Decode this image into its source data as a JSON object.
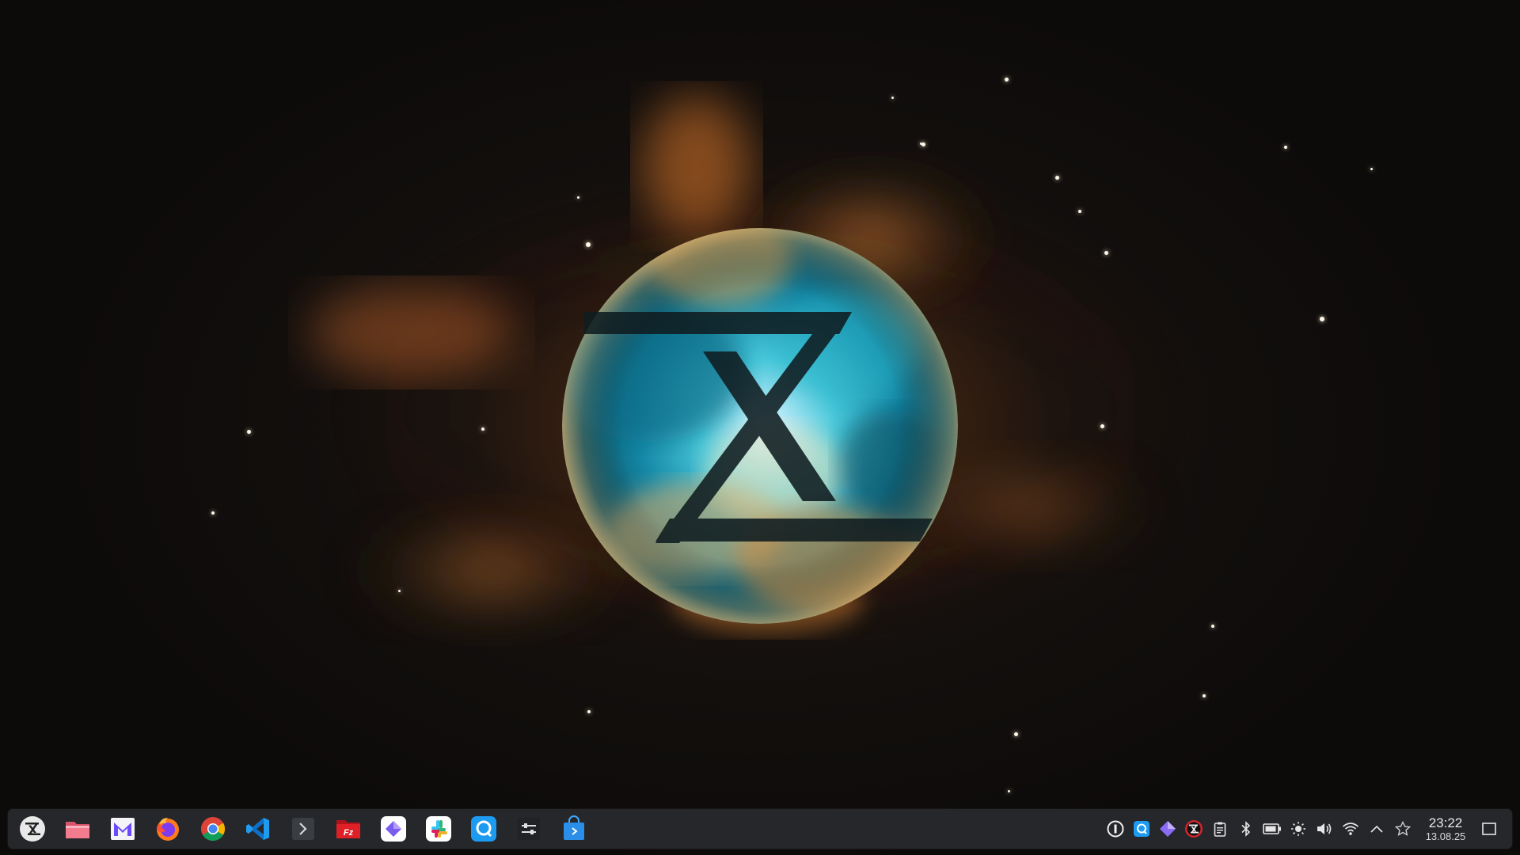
{
  "desktop": {
    "wallpaper": "nebula-with-circular-logo",
    "accent_colors": {
      "nebula_orange": "#d47a2a",
      "nebula_teal": "#1fa6b8",
      "logo_dark": "#10181b"
    }
  },
  "taskbar": {
    "background": "#25272b",
    "apps": [
      {
        "name": "app-launcher",
        "icon": "launcher-logo-icon"
      },
      {
        "name": "file-manager",
        "icon": "folder-icon"
      },
      {
        "name": "mail-client",
        "icon": "mail-icon"
      },
      {
        "name": "firefox",
        "icon": "firefox-icon"
      },
      {
        "name": "chrome",
        "icon": "chrome-icon"
      },
      {
        "name": "vscode",
        "icon": "vscode-icon"
      },
      {
        "name": "terminal",
        "icon": "terminal-icon"
      },
      {
        "name": "filezilla",
        "icon": "filezilla-icon"
      },
      {
        "name": "diamond-app",
        "icon": "diamond-icon"
      },
      {
        "name": "slack",
        "icon": "slack-icon"
      },
      {
        "name": "chat-app",
        "icon": "chat-icon"
      },
      {
        "name": "settings-tweaks",
        "icon": "sliders-icon"
      },
      {
        "name": "software-store",
        "icon": "store-icon"
      }
    ]
  },
  "tray": {
    "icons": [
      "password-manager-icon",
      "chat-tray-icon",
      "diamond-tray-icon",
      "system-logo-tray-icon",
      "clipboard-icon",
      "bluetooth-icon",
      "battery-icon",
      "brightness-icon",
      "volume-icon",
      "wifi-icon",
      "chevron-up-icon",
      "pin-icon"
    ],
    "clock": {
      "time": "23:22",
      "date": "13.08.25"
    }
  }
}
